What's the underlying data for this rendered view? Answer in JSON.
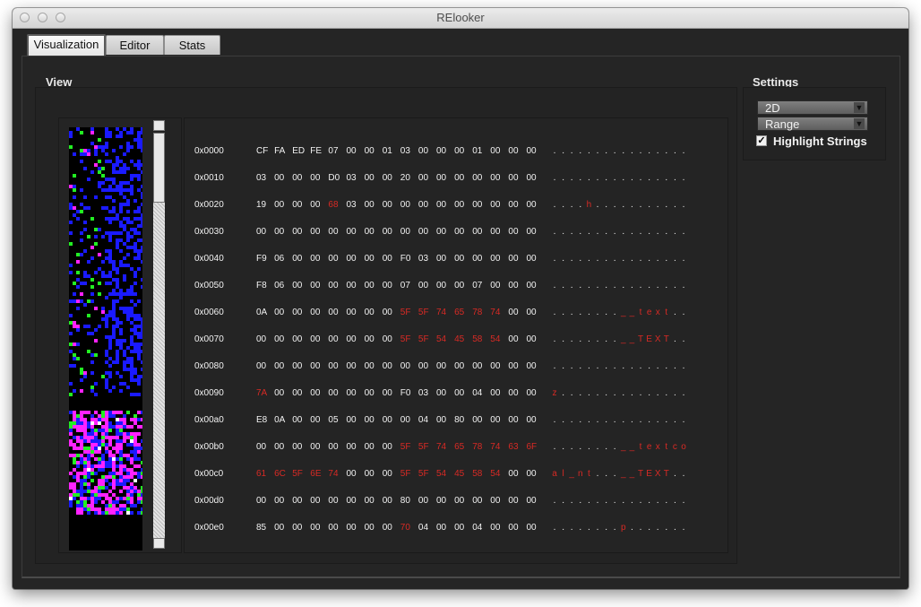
{
  "window": {
    "title": "RElooker"
  },
  "tabs": [
    {
      "label": "Visualization",
      "active": true
    },
    {
      "label": "Editor",
      "active": false
    },
    {
      "label": "Stats",
      "active": false
    }
  ],
  "view": {
    "label": "View"
  },
  "settings": {
    "label": "Settings",
    "mode_select": "2D",
    "color_select": "Range",
    "highlight_strings_label": "Highlight Strings",
    "highlight_strings_checked": true
  },
  "colors": {
    "window_bg": "#252525",
    "text": "#f2f2f2",
    "highlight": "#d82a24",
    "viz_blue": "#1a1aff",
    "viz_green": "#22ee22",
    "viz_magenta": "#ff22ff"
  },
  "hex_rows": [
    {
      "addr": "0x0000",
      "bytes": [
        "CF",
        "FA",
        "ED",
        "FE",
        "07",
        "00",
        "00",
        "01",
        "03",
        "00",
        "00",
        "00",
        "01",
        "00",
        "00",
        "00"
      ],
      "hl": [],
      "ascii": ". . . . . . . . . . . . . . . .",
      "ascii_hl": []
    },
    {
      "addr": "0x0010",
      "bytes": [
        "03",
        "00",
        "00",
        "00",
        "D0",
        "03",
        "00",
        "00",
        "20",
        "00",
        "00",
        "00",
        "00",
        "00",
        "00",
        "00"
      ],
      "hl": [],
      "ascii": ". . . . . . . . . . . . . . . .",
      "ascii_hl": []
    },
    {
      "addr": "0x0020",
      "bytes": [
        "19",
        "00",
        "00",
        "00",
        "68",
        "03",
        "00",
        "00",
        "00",
        "00",
        "00",
        "00",
        "00",
        "00",
        "00",
        "00"
      ],
      "hl": [
        4
      ],
      "ascii": ". . . . h . . . . . . . . . . .",
      "ascii_hl": [
        4
      ]
    },
    {
      "addr": "0x0030",
      "bytes": [
        "00",
        "00",
        "00",
        "00",
        "00",
        "00",
        "00",
        "00",
        "00",
        "00",
        "00",
        "00",
        "00",
        "00",
        "00",
        "00"
      ],
      "hl": [],
      "ascii": ". . . . . . . . . . . . . . . .",
      "ascii_hl": []
    },
    {
      "addr": "0x0040",
      "bytes": [
        "F9",
        "06",
        "00",
        "00",
        "00",
        "00",
        "00",
        "00",
        "F0",
        "03",
        "00",
        "00",
        "00",
        "00",
        "00",
        "00"
      ],
      "hl": [],
      "ascii": ". . . . . . . . . . . . . . . .",
      "ascii_hl": []
    },
    {
      "addr": "0x0050",
      "bytes": [
        "F8",
        "06",
        "00",
        "00",
        "00",
        "00",
        "00",
        "00",
        "07",
        "00",
        "00",
        "00",
        "07",
        "00",
        "00",
        "00"
      ],
      "hl": [],
      "ascii": ". . . . . . . . . . . . . . . .",
      "ascii_hl": []
    },
    {
      "addr": "0x0060",
      "bytes": [
        "0A",
        "00",
        "00",
        "00",
        "00",
        "00",
        "00",
        "00",
        "5F",
        "5F",
        "74",
        "65",
        "78",
        "74",
        "00",
        "00"
      ],
      "hl": [
        8,
        9,
        10,
        11,
        12,
        13
      ],
      "ascii": ". . . . . . . . _ _ t e x t . .",
      "ascii_hl": [
        8,
        9,
        10,
        11,
        12,
        13
      ]
    },
    {
      "addr": "0x0070",
      "bytes": [
        "00",
        "00",
        "00",
        "00",
        "00",
        "00",
        "00",
        "00",
        "5F",
        "5F",
        "54",
        "45",
        "58",
        "54",
        "00",
        "00"
      ],
      "hl": [
        8,
        9,
        10,
        11,
        12,
        13
      ],
      "ascii": ". . . . . . . . _ _ T E X T . .",
      "ascii_hl": [
        8,
        9,
        10,
        11,
        12,
        13
      ]
    },
    {
      "addr": "0x0080",
      "bytes": [
        "00",
        "00",
        "00",
        "00",
        "00",
        "00",
        "00",
        "00",
        "00",
        "00",
        "00",
        "00",
        "00",
        "00",
        "00",
        "00"
      ],
      "hl": [],
      "ascii": ". . . . . . . . . . . . . . . .",
      "ascii_hl": []
    },
    {
      "addr": "0x0090",
      "bytes": [
        "7A",
        "00",
        "00",
        "00",
        "00",
        "00",
        "00",
        "00",
        "F0",
        "03",
        "00",
        "00",
        "04",
        "00",
        "00",
        "00"
      ],
      "hl": [
        0
      ],
      "ascii": "z . . . . . . . . . . . . . . .",
      "ascii_hl": [
        0
      ]
    },
    {
      "addr": "0x00a0",
      "bytes": [
        "E8",
        "0A",
        "00",
        "00",
        "05",
        "00",
        "00",
        "00",
        "00",
        "04",
        "00",
        "80",
        "00",
        "00",
        "00",
        "00"
      ],
      "hl": [],
      "ascii": ". . . . . . . . . . . . . . . .",
      "ascii_hl": []
    },
    {
      "addr": "0x00b0",
      "bytes": [
        "00",
        "00",
        "00",
        "00",
        "00",
        "00",
        "00",
        "00",
        "5F",
        "5F",
        "74",
        "65",
        "78",
        "74",
        "63",
        "6F"
      ],
      "hl": [
        8,
        9,
        10,
        11,
        12,
        13,
        14,
        15
      ],
      "ascii": ". . . . . . . . _ _ t e x t c o",
      "ascii_hl": [
        8,
        9,
        10,
        11,
        12,
        13,
        14,
        15
      ]
    },
    {
      "addr": "0x00c0",
      "bytes": [
        "61",
        "6C",
        "5F",
        "6E",
        "74",
        "00",
        "00",
        "00",
        "5F",
        "5F",
        "54",
        "45",
        "58",
        "54",
        "00",
        "00"
      ],
      "hl": [
        0,
        1,
        2,
        3,
        4,
        8,
        9,
        10,
        11,
        12,
        13
      ],
      "ascii": "a l _ n t . . . _ _ T E X T . .",
      "ascii_hl": [
        0,
        1,
        2,
        3,
        4,
        8,
        9,
        10,
        11,
        12,
        13
      ]
    },
    {
      "addr": "0x00d0",
      "bytes": [
        "00",
        "00",
        "00",
        "00",
        "00",
        "00",
        "00",
        "00",
        "80",
        "00",
        "00",
        "00",
        "00",
        "00",
        "00",
        "00"
      ],
      "hl": [],
      "ascii": ". . . . . . . . . . . . . . . .",
      "ascii_hl": []
    },
    {
      "addr": "0x00e0",
      "bytes": [
        "85",
        "00",
        "00",
        "00",
        "00",
        "00",
        "00",
        "00",
        "70",
        "04",
        "00",
        "00",
        "04",
        "00",
        "00",
        "00"
      ],
      "hl": [
        8
      ],
      "ascii": ". . . . . . . . p . . . . . . .",
      "ascii_hl": [
        8
      ]
    }
  ]
}
